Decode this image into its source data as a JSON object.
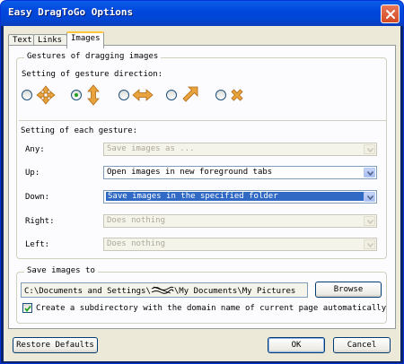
{
  "window": {
    "title": "Easy DragToGo Options"
  },
  "tabs": [
    {
      "label": "Text"
    },
    {
      "label": "Links"
    },
    {
      "label": "Images"
    }
  ],
  "gestures_group": {
    "legend": "Gestures of dragging images",
    "direction_label": "Setting of gesture direction:",
    "direction_options": [
      {
        "icon": "four-way-arrows-icon",
        "checked": false
      },
      {
        "icon": "up-down-arrows-icon",
        "checked": true
      },
      {
        "icon": "left-right-arrows-icon",
        "checked": false
      },
      {
        "icon": "diagonal-arrow-icon",
        "checked": false
      },
      {
        "icon": "x-cross-icon",
        "checked": false
      }
    ],
    "each_label": "Setting of each gesture:",
    "rows": [
      {
        "label": "Any:",
        "value": "Save images as ...",
        "enabled": false,
        "selected": false
      },
      {
        "label": "Up:",
        "value": "Open images in new foreground tabs",
        "enabled": true,
        "selected": false
      },
      {
        "label": "Down:",
        "value": "Save images in the specified folder",
        "enabled": true,
        "selected": true
      },
      {
        "label": "Right:",
        "value": "Does nothing",
        "enabled": false,
        "selected": false
      },
      {
        "label": "Left:",
        "value": "Does nothing",
        "enabled": false,
        "selected": false
      }
    ]
  },
  "save_group": {
    "legend": "Save images to",
    "path": "C:\\Documents and Settings\\[redacted]\\My Documents\\My Pictures",
    "path_prefix": "C:\\Documents and Settings\\",
    "path_suffix": "\\My Documents\\My Pictures",
    "browse_label": "Browse",
    "subdir_checked": true,
    "subdir_label": "Create a subdirectory with the domain name of current page automatically"
  },
  "footer": {
    "restore_label": "Restore Defaults",
    "ok_label": "OK",
    "cancel_label": "Cancel"
  },
  "colors": {
    "titlebar": "#0047dd",
    "accent_orange": "#e8a33c",
    "selection": "#316ac5"
  }
}
